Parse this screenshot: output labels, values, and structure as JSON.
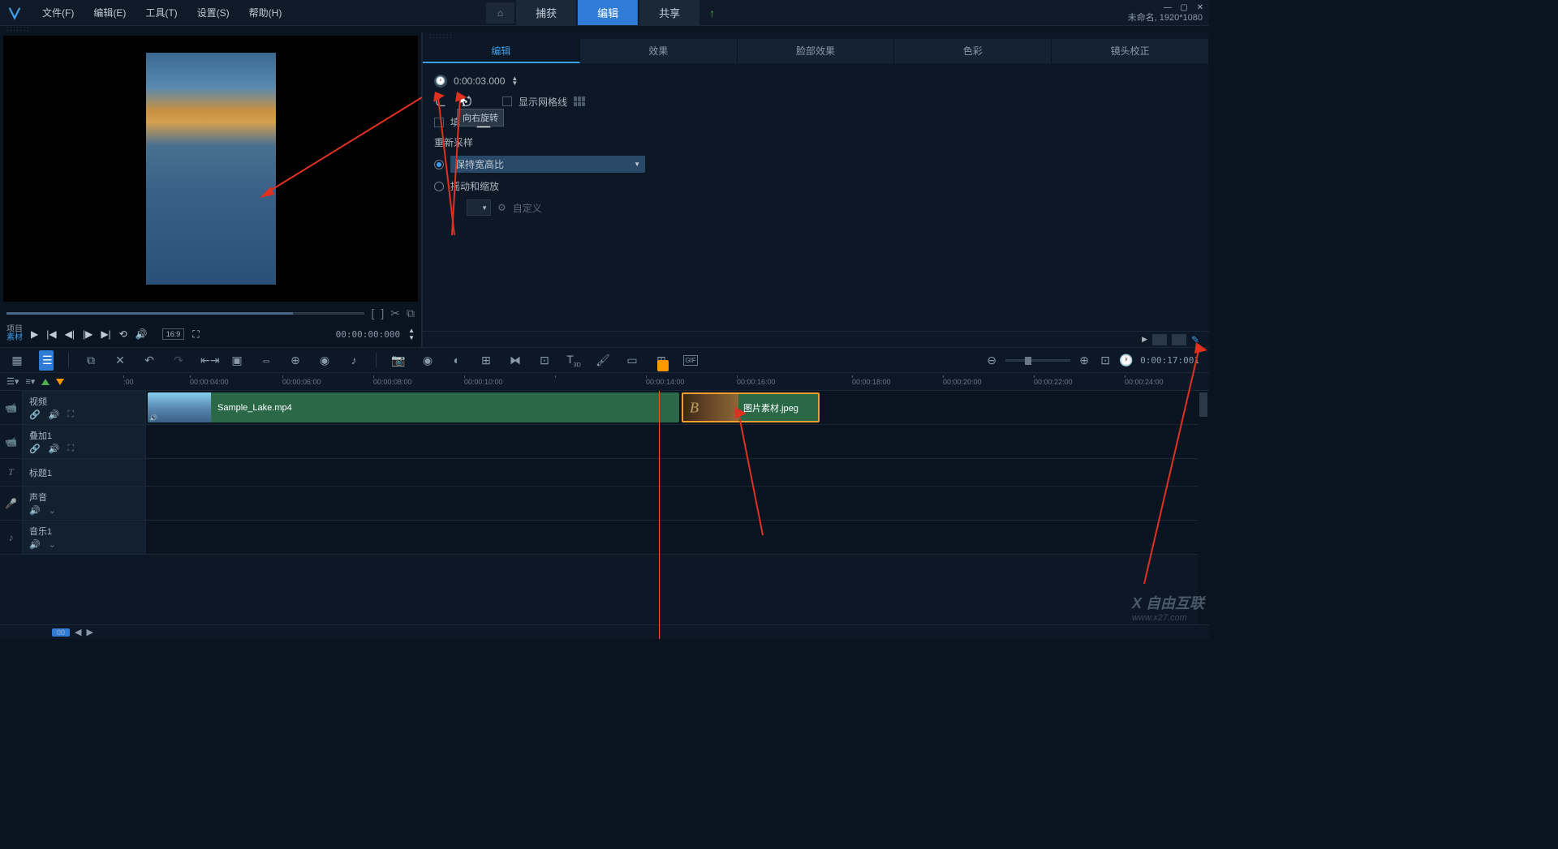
{
  "menubar": {
    "items": [
      "文件(F)",
      "编辑(E)",
      "工具(T)",
      "设置(S)",
      "帮助(H)"
    ]
  },
  "main_tabs": {
    "home_icon": "⌂",
    "tabs": [
      "捕获",
      "编辑",
      "共享"
    ],
    "active_index": 1,
    "upload_icon": "↑"
  },
  "title_info": "未命名, 1920*1080",
  "preview": {
    "project_label": "项目",
    "material_label": "素材",
    "mark_in": "[",
    "mark_out": "]",
    "aspect": "16:9",
    "timecode": "00:00:00:000",
    "scrub_icons": {
      "scissors": "✂",
      "copy": "⧉"
    }
  },
  "props": {
    "tabs": [
      "编辑",
      "效果",
      "脸部效果",
      "色彩",
      "镜头校正"
    ],
    "active_index": 0,
    "duration": "0:00:03.000",
    "grid_label": "显示网格线",
    "fill_label": "填充",
    "resample_label": "重新采样",
    "rotate_tooltip": "向右旋转",
    "option_keep_ratio": "保持宽高比",
    "option_pan_zoom": "摇动和缩放",
    "custom_label": "自定义"
  },
  "toolbar": {
    "zoom_time": "0:00:17:001"
  },
  "ruler": {
    "marks": [
      {
        "label": ":00",
        "pos": 0
      },
      {
        "label": "00:00:04:00",
        "pos": 82
      },
      {
        "label": "00:00:06:00",
        "pos": 196
      },
      {
        "label": "00:00:08:00",
        "pos": 308
      },
      {
        "label": "00:00:10:00",
        "pos": 420
      },
      {
        "label": "",
        "pos": 532
      },
      {
        "label": "00:00:14:00",
        "pos": 644
      },
      {
        "label": "00:00:16:00",
        "pos": 756
      },
      {
        "label": "00:00:18:00",
        "pos": 898
      },
      {
        "label": "00:00:20:00",
        "pos": 1010
      },
      {
        "label": "00:00:22:00",
        "pos": 1122
      },
      {
        "label": "00:00:24:00",
        "pos": 1234
      }
    ]
  },
  "tracks": [
    {
      "icon": "📹",
      "name": "视频",
      "controls": [
        "🔗",
        "🔊",
        "⛶"
      ]
    },
    {
      "icon": "📹",
      "name": "叠加1",
      "controls": [
        "🔗",
        "🔊",
        "⛶"
      ]
    },
    {
      "icon": "T",
      "name": "标题1",
      "controls": []
    },
    {
      "icon": "🎤",
      "name": "声音",
      "controls": [
        "",
        "🔊",
        "⌄"
      ]
    },
    {
      "icon": "♪",
      "name": "音乐1",
      "controls": [
        "",
        "🔊",
        "⌄"
      ]
    }
  ],
  "clips": {
    "video_name": "Sample_Lake.mp4",
    "image_name": "图片素材.jpeg"
  },
  "watermark": {
    "brand": "X 自由互联",
    "url": "www.x27.com"
  },
  "bottom_badge": "00"
}
